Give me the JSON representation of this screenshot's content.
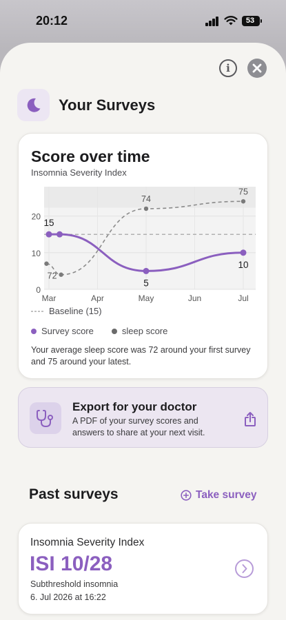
{
  "status_bar": {
    "time": "20:12",
    "battery": "53"
  },
  "header": {
    "title": "Your Surveys",
    "icon": "moon-icon"
  },
  "chart_card": {
    "title": "Score over time",
    "subtitle": "Insomnia Severity Index",
    "baseline_label": "Baseline (15)",
    "legend": [
      {
        "label": "Survey score",
        "color": "#8b5fbf"
      },
      {
        "label": "sleep score",
        "color": "#6b6b6b"
      }
    ],
    "summary": "Your average sleep score was 72 around your first survey and 75 around your latest."
  },
  "chart_data": {
    "type": "line",
    "title": "Score over time",
    "subtitle": "Insomnia Severity Index",
    "categories": [
      "Mar",
      "Apr",
      "May",
      "Jun",
      "Jul"
    ],
    "ylim": [
      0,
      28
    ],
    "yticks": [
      "0",
      "10",
      "20"
    ],
    "baseline": 15,
    "series": [
      {
        "name": "Survey score",
        "color": "#8b5fbf",
        "points": [
          {
            "x": 0,
            "y": 15,
            "label": "15"
          },
          {
            "x": 0.22,
            "y": 15,
            "label": ""
          },
          {
            "x": 2,
            "y": 5,
            "label": "5"
          },
          {
            "x": 4,
            "y": 10,
            "label": "10"
          }
        ]
      },
      {
        "name": "sleep score",
        "color": "#8a8a8a",
        "points": [
          {
            "x": -0.05,
            "y": 7,
            "label": ""
          },
          {
            "x": 0.25,
            "y": 4,
            "label": "72"
          },
          {
            "x": 2,
            "y": 22,
            "label": "74"
          },
          {
            "x": 4,
            "y": 24,
            "label": "75"
          }
        ]
      }
    ]
  },
  "export": {
    "title": "Export for your doctor",
    "description": "A PDF of your survey scores and answers to share at your next visit."
  },
  "past_surveys": {
    "title": "Past surveys",
    "take_survey_label": "Take survey",
    "items": [
      {
        "name": "Insomnia Severity Index",
        "score": "ISI 10/28",
        "level": "Subthreshold insomnia",
        "date": "6. Jul 2026 at 16:22"
      }
    ]
  }
}
